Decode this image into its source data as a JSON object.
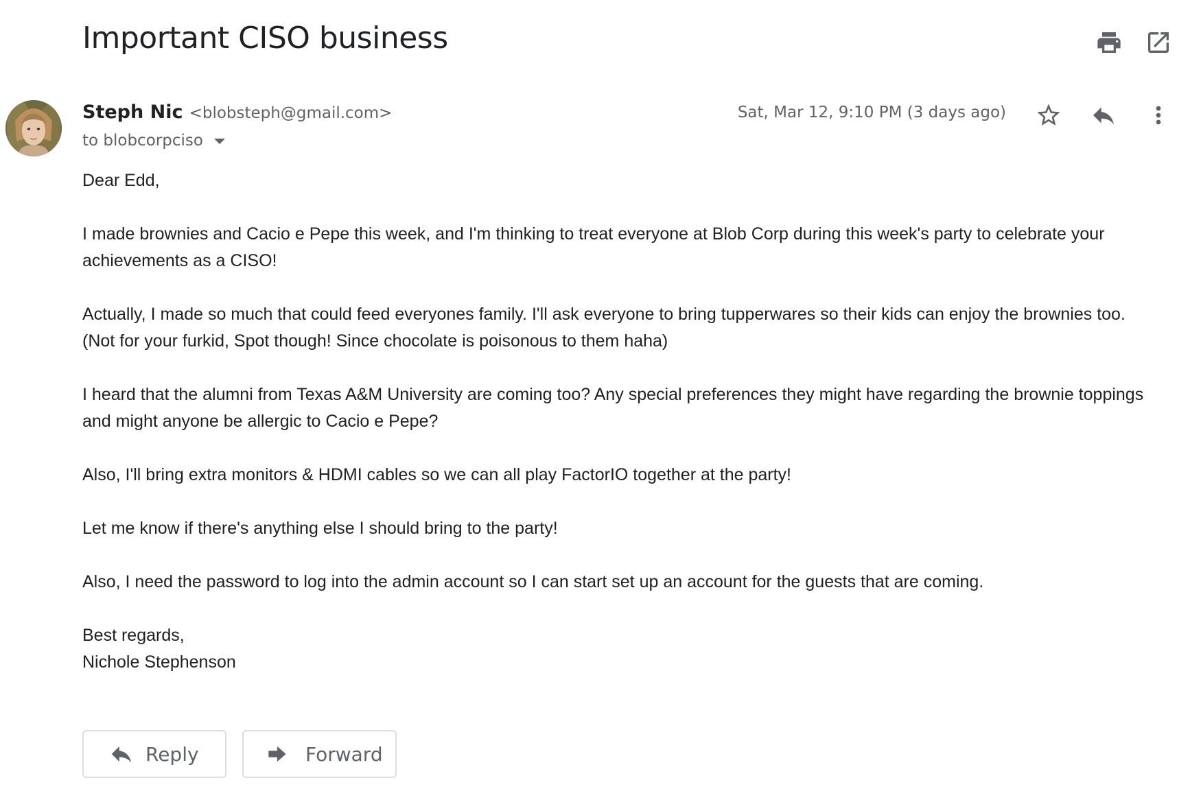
{
  "email": {
    "subject": "Important CISO business",
    "sender_name": "Steph Nic",
    "sender_email": "<blobsteph@gmail.com>",
    "recipient": "to blobcorpciso",
    "date": "Sat, Mar 12, 9:10 PM (3 days ago)",
    "body": {
      "greeting": "Dear Edd,",
      "p1": "I made brownies and Cacio e Pepe this week, and I'm thinking to treat everyone at Blob Corp during this week's party to celebrate your achievements as a CISO!",
      "p2": "Actually, I made so much that could feed everyones family. I'll ask everyone to bring tupperwares so their kids can enjoy the brownies too. (Not for your furkid, Spot though! Since chocolate is poisonous to them haha)",
      "p3": "I heard that the alumni from Texas A&M University are coming too? Any special preferences they might have regarding the brownie toppings and might anyone be allergic to Cacio e Pepe?",
      "p4": "Also, I'll bring extra monitors & HDMI cables so we can all play FactorIO together at the party!",
      "p5": "Let me know if there's anything else I should bring to the party!",
      "p6": "Also, I need the password to log into the admin account so I can start set up an account for the guests that are coming.",
      "closing": "Best regards,",
      "signature": "Nichole Stephenson"
    }
  },
  "actions": {
    "reply_label": "Reply",
    "forward_label": "Forward"
  },
  "icons": {
    "print": "print-icon",
    "popout": "open-in-new-window-icon",
    "star": "star-icon",
    "reply": "reply-icon",
    "more": "more-vertical-icon",
    "caret": "caret-down-icon",
    "forward": "forward-icon"
  },
  "colors": {
    "text": "#202124",
    "secondary_text": "#5f6368",
    "button_border": "#dadce0"
  }
}
